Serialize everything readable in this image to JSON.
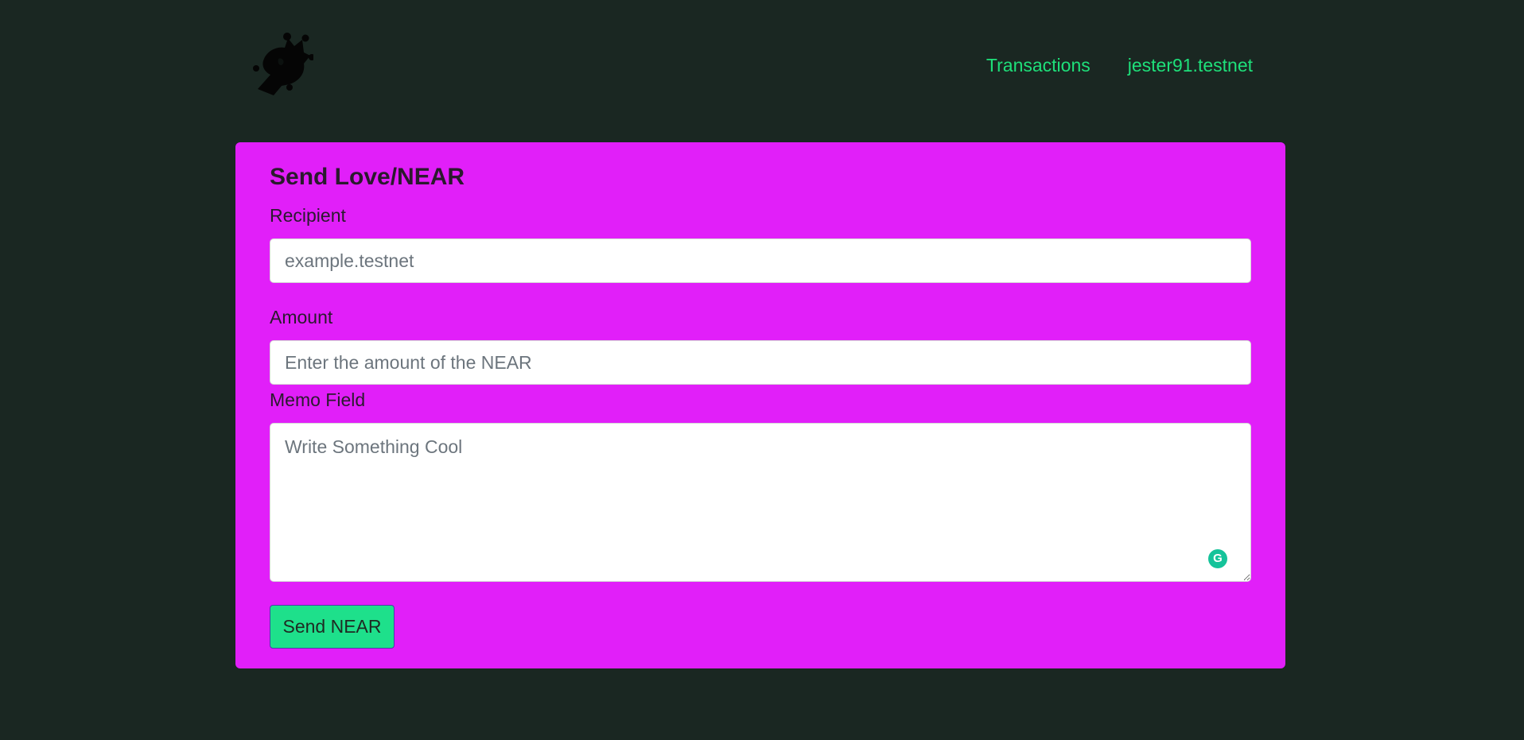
{
  "header": {
    "logo_icon": "jester-hat-icon",
    "nav": {
      "transactions_label": "Transactions",
      "account_label": "jester91.testnet"
    }
  },
  "form": {
    "title": "Send Love/NEAR",
    "recipient": {
      "label": "Recipient",
      "value": "",
      "placeholder": "example.testnet"
    },
    "amount": {
      "label": "Amount",
      "value": "",
      "placeholder": "Enter the amount of the NEAR"
    },
    "memo": {
      "label": "Memo Field",
      "value": "",
      "placeholder": "Write Something Cool"
    },
    "submit_label": "Send NEAR"
  },
  "colors": {
    "background": "#1a2722",
    "accent": "#1ee07a",
    "card": "#e11ff9",
    "button": "#1ee08b"
  }
}
